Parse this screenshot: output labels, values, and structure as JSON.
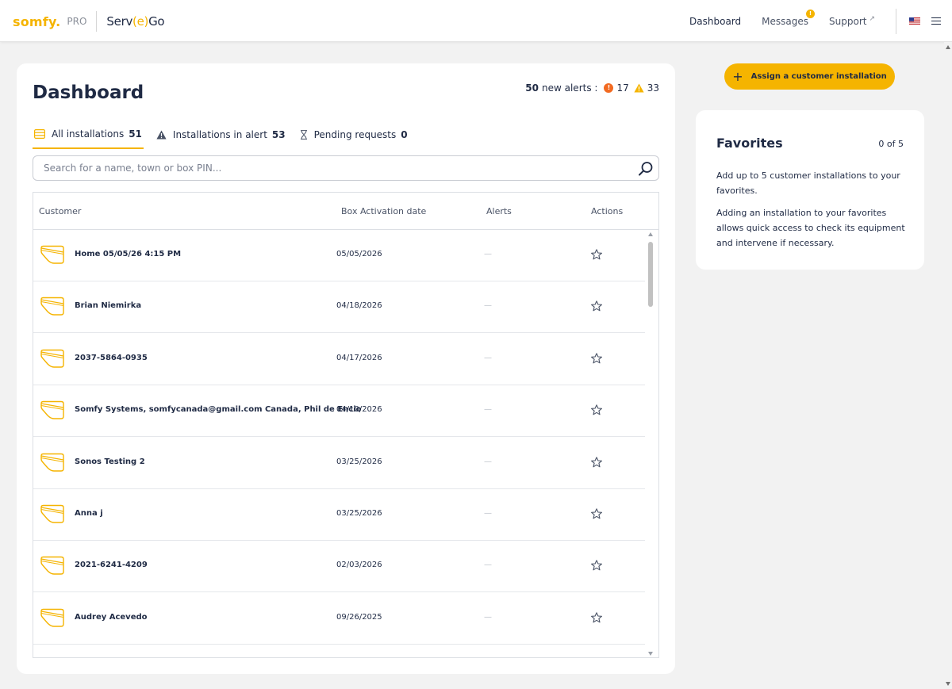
{
  "header": {
    "logo_somfy": "somfy.",
    "logo_pro": "PRO",
    "logo_servego_pre": "Serv",
    "logo_servego_e": "(e)",
    "logo_servego_post": "Go",
    "nav": {
      "dashboard": "Dashboard",
      "messages": "Messages",
      "messages_badge": "!",
      "support": "Support",
      "support_ext": "↗"
    }
  },
  "main": {
    "title": "Dashboard",
    "alerts": {
      "count_label": "50",
      "text": "new alerts :",
      "errors": "17",
      "warnings": "33"
    },
    "tabs": [
      {
        "label": "All installations",
        "count": "51"
      },
      {
        "label": "Installations in alert",
        "count": "53"
      },
      {
        "label": "Pending requests",
        "count": "0"
      }
    ],
    "search": {
      "placeholder": "Search for a name, town or box PIN..."
    },
    "table": {
      "headers": {
        "customer": "Customer",
        "activation": "Box Activation date",
        "alerts": "Alerts",
        "actions": "Actions"
      },
      "rows": [
        {
          "customer": "Home 05/05/26 4:15 PM",
          "date": "05/05/2026",
          "alerts": "—"
        },
        {
          "customer": "Brian Niemirka",
          "date": "04/18/2026",
          "alerts": "—"
        },
        {
          "customer": "2037-5864-0935",
          "date": "04/17/2026",
          "alerts": "—"
        },
        {
          "customer": "Somfy Systems, somfycanada@gmail.com Canada, Phil de Encio",
          "date": "04/10/2026",
          "alerts": "—"
        },
        {
          "customer": "Sonos Testing 2",
          "date": "03/25/2026",
          "alerts": "—"
        },
        {
          "customer": "Anna j",
          "date": "03/25/2026",
          "alerts": "—"
        },
        {
          "customer": "2021-6241-4209",
          "date": "02/03/2026",
          "alerts": "—"
        },
        {
          "customer": "Audrey Acevedo",
          "date": "09/26/2025",
          "alerts": "—"
        }
      ]
    }
  },
  "sidebar": {
    "assign_button": "Assign a customer installation",
    "favorites": {
      "title": "Favorites",
      "count": "0 of 5",
      "text1": "Add up to 5 customer installations to your favorites.",
      "text2": "Adding an installation to your favorites allows quick access to check its equipment and intervene if necessary."
    }
  },
  "colors": {
    "accent": "#f5b400",
    "error": "#f26a21",
    "text": "#1f2a44",
    "background": "#f2f2f2"
  },
  "icons": {
    "folder": "installation-folder-icon",
    "star": "favorite-star-icon",
    "search": "search-icon",
    "menu": "hamburger-menu-icon",
    "flag": "us-flag-icon"
  }
}
